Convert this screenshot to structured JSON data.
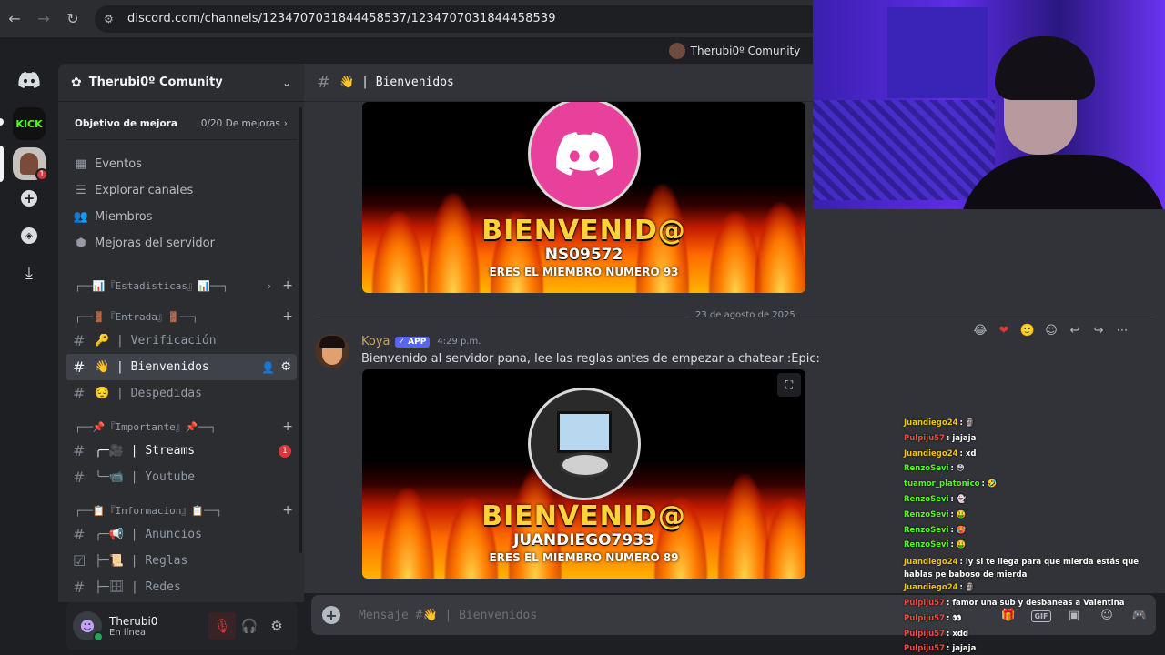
{
  "browser": {
    "url": "discord.com/channels/1234707031844458537/1234707031844458539"
  },
  "rail": {
    "items": [
      "discord-home",
      "kick-server",
      "therubi-server",
      "add-server",
      "explore",
      "download"
    ],
    "kick_label": "KICK",
    "server_badge": "1"
  },
  "guild_top": {
    "name": "Therubi0º Comunity"
  },
  "server": {
    "name": "Therubi0º Comunity",
    "boost_goal_label": "Objetivo de mejora",
    "boost_goal_value": "0/20 De mejoras"
  },
  "nav_links": [
    {
      "label": "Eventos",
      "icon": "calendar-icon"
    },
    {
      "label": "Explorar canales",
      "icon": "list-icon"
    },
    {
      "label": "Miembros",
      "icon": "members-icon"
    },
    {
      "label": "Mejoras del servidor",
      "icon": "boost-icon"
    }
  ],
  "categories": [
    "┌──📊『Estadisticas』📊──┐",
    "┌──🚪『Entrada』🚪──┐",
    "┌──📌『Importante』📌──┐",
    "┌──📋『Informacion』📋──┐"
  ],
  "channels": {
    "verificacion": "🔑 | Verificación",
    "bienvenidos": "👋 | Bienvenidos",
    "despedidas": "😔 | Despedidas",
    "streams": "╭─🎥 | Streams",
    "streams_badge": "1",
    "youtube": "╰─📹 | Youtube",
    "anuncios": "╭─📢 | Anuncios",
    "reglas": "├─📜 | Reglas",
    "redes": "├─🗄 | Redes"
  },
  "user": {
    "name": "Therubi0",
    "status": "En línea"
  },
  "channel_header": {
    "name": "👋 | Bienvenidos"
  },
  "welcome_1": {
    "title": "BIENVENID@",
    "nick": "NS09572",
    "member": "ERES EL MIEMBRO NUMERO 93"
  },
  "date_divider": "23 de agosto de 2025",
  "message": {
    "author": "Koya",
    "tag": "✓ APP",
    "time": "4:29 p.m.",
    "text": "Bienvenido al servidor pana, lee las reglas antes de empezar a chatear :Epic:"
  },
  "welcome_2": {
    "title": "BIENVENID@",
    "nick": "JUANDIEGO7933",
    "member": "ERES EL MIEMBRO NUMERO 89"
  },
  "composer": {
    "placeholder": "Mensaje #👋 | Bienvenidos",
    "gif_label": "GIF"
  },
  "stream_chat": [
    {
      "user": "Juandiego24",
      "text": ": 🗿",
      "color": "#f1c40f"
    },
    {
      "user": "Pulpiju57",
      "text": ": jajaja",
      "color": "#e74c3c"
    },
    {
      "user": "Juandiego24",
      "text": ": xd",
      "color": "#f1c40f"
    },
    {
      "user": "RenzoSevi",
      "text": ": 😳",
      "color": "#53fc18"
    },
    {
      "user": "tuamor_platonico",
      "text": ": 🤣",
      "color": "#53fc18"
    },
    {
      "user": "RenzoSevi",
      "text": ": 👻",
      "color": "#53fc18"
    },
    {
      "user": "RenzoSevi",
      "text": ": 🤑",
      "color": "#53fc18"
    },
    {
      "user": "RenzoSevi",
      "text": ": 🥵",
      "color": "#53fc18"
    },
    {
      "user": "RenzoSevi",
      "text": ": 🤑",
      "color": "#53fc18"
    },
    {
      "user": "Juandiego24",
      "text": ": ly si te llega para que mierda estás que hablas pe baboso de mierda",
      "color": "#f1c40f",
      "wrap": true
    },
    {
      "user": "Juandiego24",
      "text": ": 🗿",
      "color": "#f1c40f"
    },
    {
      "user": "Pulpiju57",
      "text": ": famor una sub y desbaneas a Valentina",
      "color": "#e74c3c"
    },
    {
      "user": "Pulpiju57",
      "text": ": 👀",
      "color": "#e74c3c"
    },
    {
      "user": "Pulpiju57",
      "text": ": xdd",
      "color": "#e74c3c"
    },
    {
      "user": "Pulpiju57",
      "text": ": jajaja",
      "color": "#e74c3c"
    }
  ]
}
